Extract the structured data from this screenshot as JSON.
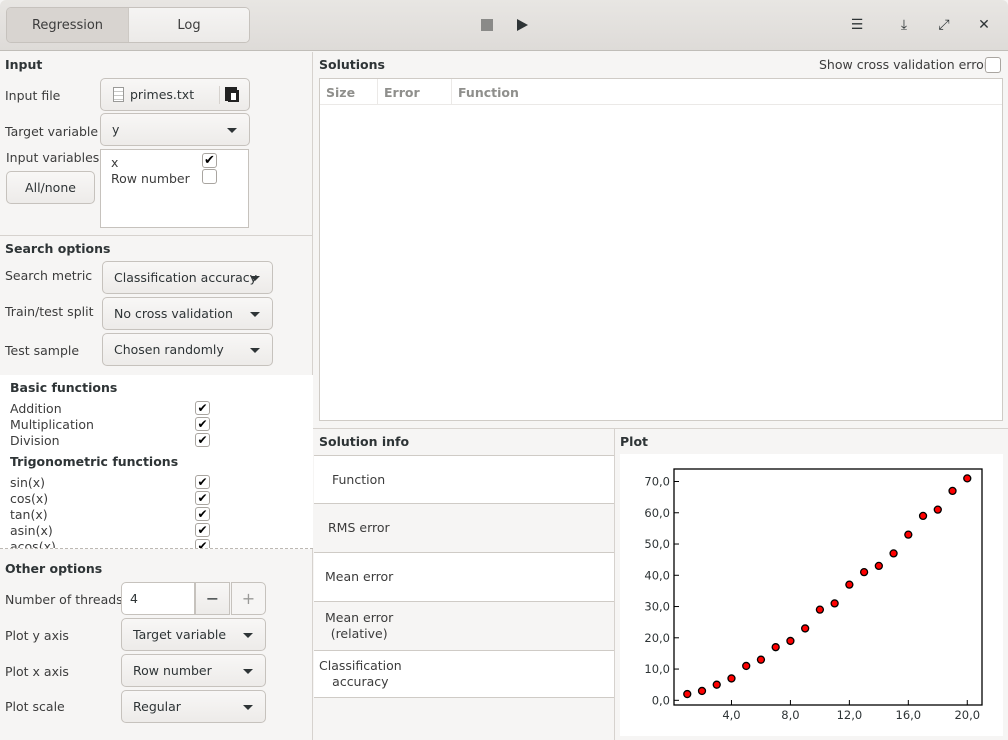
{
  "header": {
    "tabs": [
      {
        "label": "Regression",
        "active": true
      },
      {
        "label": "Log",
        "active": false
      }
    ],
    "icons": {
      "stop": "stop-icon",
      "play": "play-icon",
      "menu": "☰",
      "download": "⤓",
      "fullscreen": "⤢",
      "close": "✕"
    }
  },
  "input": {
    "title": "Input",
    "input_file_label": "Input file",
    "input_file_value": "primes.txt",
    "target_variable_label": "Target variable",
    "target_variable_value": "y",
    "input_variables_label": "Input variables",
    "all_none_label": "All/none",
    "variables": [
      {
        "name": "x",
        "checked": true
      },
      {
        "name": "Row number",
        "checked": false
      }
    ]
  },
  "search_options": {
    "title": "Search options",
    "search_metric_label": "Search metric",
    "search_metric_value": "Classification accuracy",
    "split_label": "Train/test split",
    "split_value": "No cross validation",
    "test_sample_label": "Test sample",
    "test_sample_value": "Chosen randomly"
  },
  "functions": {
    "groups": [
      {
        "title": "Basic functions",
        "items": [
          {
            "name": "Addition",
            "checked": true
          },
          {
            "name": "Multiplication",
            "checked": true
          },
          {
            "name": "Division",
            "checked": true
          }
        ]
      },
      {
        "title": "Trigonometric functions",
        "items": [
          {
            "name": "sin(x)",
            "checked": true
          },
          {
            "name": "cos(x)",
            "checked": true
          },
          {
            "name": "tan(x)",
            "checked": true
          },
          {
            "name": "asin(x)",
            "checked": true
          },
          {
            "name": "acos(x)",
            "checked": true
          }
        ]
      }
    ],
    "check_glyph": "✔"
  },
  "other_options": {
    "title": "Other options",
    "threads_label": "Number of threads",
    "threads_value": "4",
    "minus": "−",
    "plus": "+",
    "plot_y_label": "Plot y axis",
    "plot_y_value": "Target variable",
    "plot_x_label": "Plot x axis",
    "plot_x_value": "Row number",
    "plot_scale_label": "Plot scale",
    "plot_scale_value": "Regular"
  },
  "solutions": {
    "title": "Solutions",
    "show_cv_label": "Show cross validation error",
    "show_cv_checked": false,
    "columns": [
      "Size",
      "Error",
      "Function"
    ],
    "rows": []
  },
  "solution_info": {
    "title": "Solution info",
    "rows": [
      "Function",
      "RMS error",
      "Mean error",
      "Mean error\n(relative)",
      "Classification\naccuracy"
    ]
  },
  "plot": {
    "title": "Plot"
  },
  "chart_data": {
    "type": "scatter",
    "title": "",
    "xlabel": "",
    "ylabel": "",
    "x": [
      1,
      2,
      3,
      4,
      5,
      6,
      7,
      8,
      9,
      10,
      11,
      12,
      13,
      14,
      15,
      16,
      17,
      18,
      19,
      20
    ],
    "y": [
      2,
      3,
      5,
      7,
      11,
      13,
      17,
      19,
      23,
      29,
      31,
      37,
      41,
      43,
      47,
      53,
      59,
      61,
      67,
      71
    ],
    "xlim": [
      0.1,
      21.0
    ],
    "ylim": [
      -1.5,
      74.0
    ],
    "xticks": [
      4,
      8,
      12,
      16,
      20
    ],
    "xtick_labels": [
      "4,0",
      "8,0",
      "12,0",
      "16,0",
      "20,0"
    ],
    "yticks": [
      0,
      10,
      20,
      30,
      40,
      50,
      60,
      70
    ],
    "ytick_labels": [
      "0,0",
      "10,0",
      "20,0",
      "30,0",
      "40,0",
      "50,0",
      "60,0",
      "70,0"
    ],
    "grid": false,
    "marker_color": "#ff0000",
    "marker_edge_color": "#000000"
  }
}
